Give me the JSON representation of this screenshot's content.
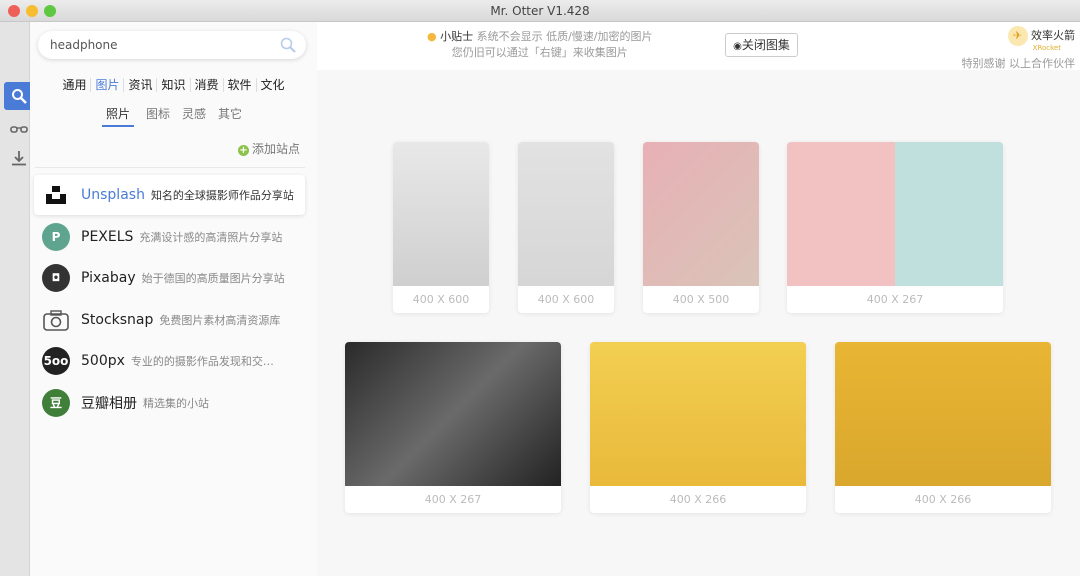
{
  "window": {
    "title": "Mr. Otter V1.428"
  },
  "search": {
    "value": "headphone"
  },
  "categories": [
    {
      "label": "通用"
    },
    {
      "label": "图片",
      "active": true
    },
    {
      "label": "资讯"
    },
    {
      "label": "知识"
    },
    {
      "label": "消费"
    },
    {
      "label": "软件"
    },
    {
      "label": "文化"
    }
  ],
  "subcategories": [
    {
      "label": "照片",
      "active": true
    },
    {
      "label": "图标"
    },
    {
      "label": "灵感"
    },
    {
      "label": "其它"
    }
  ],
  "add_site": "添加站点",
  "sites": [
    {
      "name": "Unsplash",
      "desc": "知名的全球摄影师作品分享站",
      "logo": "unsplash",
      "color": "#111111"
    },
    {
      "name": "PEXELS",
      "desc": "充满设计感的高清照片分享站",
      "logo": "P",
      "color": "#5fa48e"
    },
    {
      "name": "Pixabay",
      "desc": "始于德国的高质量图片分享站",
      "logo": "camera",
      "color": "#333333"
    },
    {
      "name": "Stocksnap",
      "desc": "免费图片素材高清资源库",
      "logo": "camera-outline",
      "color": "#555555"
    },
    {
      "name": "500px",
      "desc": "专业的的摄影作品发现和交易平台",
      "logo": "5oo",
      "color": "#222222"
    },
    {
      "name": "豆瓣相册",
      "desc": "精选集的小站",
      "logo": "豆",
      "color": "#3f7f3a"
    }
  ],
  "header": {
    "tip_title": "小贴士",
    "tip_line1": "系统不会显示 低质/慢速/加密的图片",
    "tip_line2": "您仍旧可以通过「右键」来收集图片",
    "close_gallery": "关闭图集",
    "partner_name": "效率火箭",
    "partner_sub": "XRocket",
    "partner_thanks": "特别感谢 以上合作伙伴"
  },
  "images": [
    {
      "size": "400 X 600",
      "bg": "linear-gradient(#e8e8e8,#cfcfcf)"
    },
    {
      "size": "400 X 600",
      "bg": "linear-gradient(#e2e2e2,#d6d6d6)"
    },
    {
      "size": "400 X 500",
      "bg": "linear-gradient(135deg,#e8b0b5,#d9c4b8)"
    },
    {
      "size": "400 X 267",
      "bg": "linear-gradient(90deg,#f2c2c2 50%,#bfe0dc 50%)"
    },
    {
      "size": "400 X 267",
      "bg": "linear-gradient(135deg,#2a2a2a,#6a6a6a,#222)"
    },
    {
      "size": "400 X 266",
      "bg": "linear-gradient(#f2cf52,#e9b93a)"
    },
    {
      "size": "400 X 266",
      "bg": "linear-gradient(#e9b534,#d9a72c)"
    }
  ]
}
